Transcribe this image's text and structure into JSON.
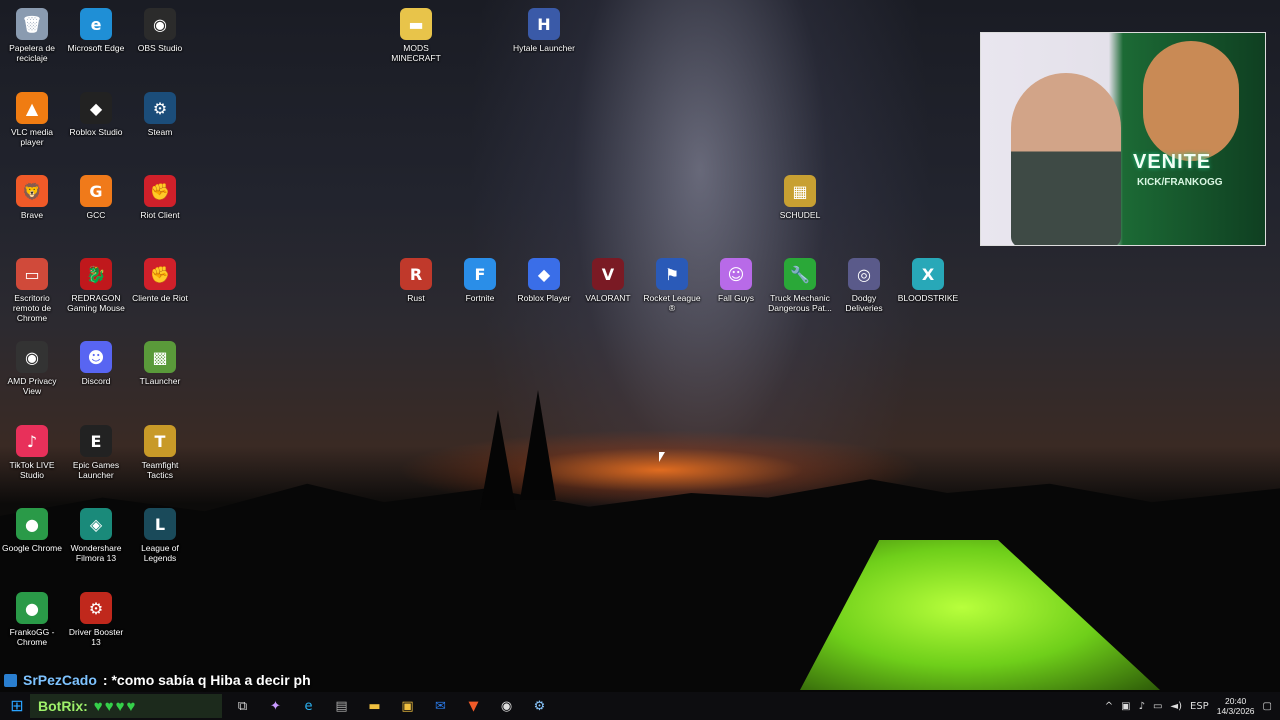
{
  "desktop_icons": [
    {
      "label": "Papelera de reciclaje",
      "glyph": "🗑",
      "bg": "#8a9bb0"
    },
    {
      "label": "Microsoft Edge",
      "glyph": "e",
      "bg": "#1f8fd6"
    },
    {
      "label": "OBS Studio",
      "glyph": "◉",
      "bg": "#2b2b2b"
    },
    {
      "label": "MODS MINECRAFT",
      "glyph": "▬",
      "bg": "#e8c44a"
    },
    {
      "label": "Hytale Launcher",
      "glyph": "H",
      "bg": "#3a5aa8"
    },
    {
      "label": "VLC media player",
      "glyph": "▲",
      "bg": "#f07c12"
    },
    {
      "label": "Roblox Studio",
      "glyph": "◆",
      "bg": "#222"
    },
    {
      "label": "Steam",
      "glyph": "⚙",
      "bg": "#1b4d7a"
    },
    {
      "label": "SCHUDEL",
      "glyph": "▦",
      "bg": "#c8a032"
    },
    {
      "label": "Brave",
      "glyph": "🦁",
      "bg": "#f05a28"
    },
    {
      "label": "GCC",
      "glyph": "G",
      "bg": "#f07a1a"
    },
    {
      "label": "Riot Client",
      "glyph": "✊",
      "bg": "#d0202a"
    },
    {
      "label": "Escritorio remoto de Chrome",
      "glyph": "▭",
      "bg": "#d04a3a"
    },
    {
      "label": "REDRAGON Gaming Mouse",
      "glyph": "🐉",
      "bg": "#c0181c"
    },
    {
      "label": "Cliente de Riot",
      "glyph": "✊",
      "bg": "#d0202a"
    },
    {
      "label": "Rust",
      "glyph": "R",
      "bg": "#c0392b"
    },
    {
      "label": "Fortnite",
      "glyph": "F",
      "bg": "#2a8ee8"
    },
    {
      "label": "Roblox Player",
      "glyph": "◆",
      "bg": "#3a6ee8"
    },
    {
      "label": "VALORANT",
      "glyph": "V",
      "bg": "#7a1a24"
    },
    {
      "label": "Rocket League ®",
      "glyph": "⚑",
      "bg": "#2a5ab8"
    },
    {
      "label": "Fall Guys",
      "glyph": "☺",
      "bg": "#b86ae8"
    },
    {
      "label": "Truck Mechanic Dangerous Pat...",
      "glyph": "🔧",
      "bg": "#2aa838"
    },
    {
      "label": "Dodgy Deliveries",
      "glyph": "◎",
      "bg": "#5a5a8a"
    },
    {
      "label": "BLOODSTRIKE",
      "glyph": "X",
      "bg": "#28a8b8"
    },
    {
      "label": "AMD Privacy View",
      "glyph": "◉",
      "bg": "#333"
    },
    {
      "label": "Discord",
      "glyph": "☻",
      "bg": "#5865f2"
    },
    {
      "label": "TLauncher",
      "glyph": "▩",
      "bg": "#5a9a3a"
    },
    {
      "label": "TikTok LIVE Studio",
      "glyph": "♪",
      "bg": "#e8305a"
    },
    {
      "label": "Epic Games Launcher",
      "glyph": "E",
      "bg": "#222"
    },
    {
      "label": "Teamfight Tactics",
      "glyph": "T",
      "bg": "#c89a28"
    },
    {
      "label": "Google Chrome",
      "glyph": "●",
      "bg": "#2a9a48"
    },
    {
      "label": "Wondershare Filmora 13",
      "glyph": "◈",
      "bg": "#1a8a7a"
    },
    {
      "label": "League of Legends",
      "glyph": "L",
      "bg": "#1a4a5a"
    },
    {
      "label": "FrankoGG - Chrome",
      "glyph": "●",
      "bg": "#2a9a48"
    },
    {
      "label": "Driver Booster 13",
      "glyph": "⚙",
      "bg": "#c0281c"
    }
  ],
  "webcam": {
    "overlay_text": "VENITE",
    "overlay_sub": "KICK/FRANKOGG"
  },
  "chat": {
    "username": "SrPezCado",
    "message": ": *como sabía q Hiba a decir ph"
  },
  "botrix": {
    "name": "BotRix:",
    "hearts": "♥♥♥♥"
  },
  "taskbar": {
    "apps": [
      {
        "name": "task-view-icon",
        "glyph": "⧉",
        "color": "#ddd"
      },
      {
        "name": "copilot-icon",
        "glyph": "✦",
        "color": "#c89aff"
      },
      {
        "name": "edge-icon",
        "glyph": "e",
        "color": "#2ab0ef"
      },
      {
        "name": "explorer-window-icon",
        "glyph": "▤",
        "color": "#aaa"
      },
      {
        "name": "file-explorer-icon",
        "glyph": "▬",
        "color": "#f0c040"
      },
      {
        "name": "store-icon",
        "glyph": "▣",
        "color": "#f0c040"
      },
      {
        "name": "mail-icon",
        "glyph": "✉",
        "color": "#2a7ae8"
      },
      {
        "name": "brave-icon",
        "glyph": "▼",
        "color": "#f05a28"
      },
      {
        "name": "obs-icon",
        "glyph": "◉",
        "color": "#ddd"
      },
      {
        "name": "steam-icon",
        "glyph": "⚙",
        "color": "#8ac8ff"
      }
    ],
    "language": "ESP",
    "time": "20:40",
    "date": "14/3/2026"
  }
}
